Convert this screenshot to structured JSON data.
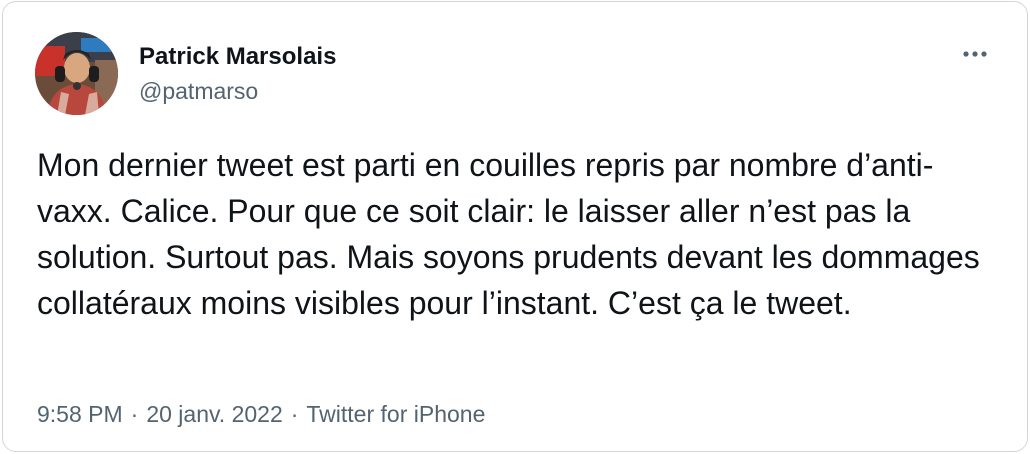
{
  "author": {
    "display_name": "Patrick Marsolais",
    "handle": "@patmarso"
  },
  "tweet": {
    "text": "Mon dernier tweet est parti en couilles repris par nombre d’anti-vaxx. Calice. Pour que ce soit clair: le laisser aller n’est pas la solution. Surtout pas. Mais soyons prudents devant les dommages collatéraux moins visibles pour l’instant. C’est ça le tweet."
  },
  "meta": {
    "time": "9:58 PM",
    "date": "20 janv. 2022",
    "source": "Twitter for iPhone",
    "separator": "·"
  },
  "icons": {
    "more": "more-horizontal-icon"
  },
  "colors": {
    "text_primary": "#0f1419",
    "text_secondary": "#536471",
    "border": "#d0d7dc"
  }
}
